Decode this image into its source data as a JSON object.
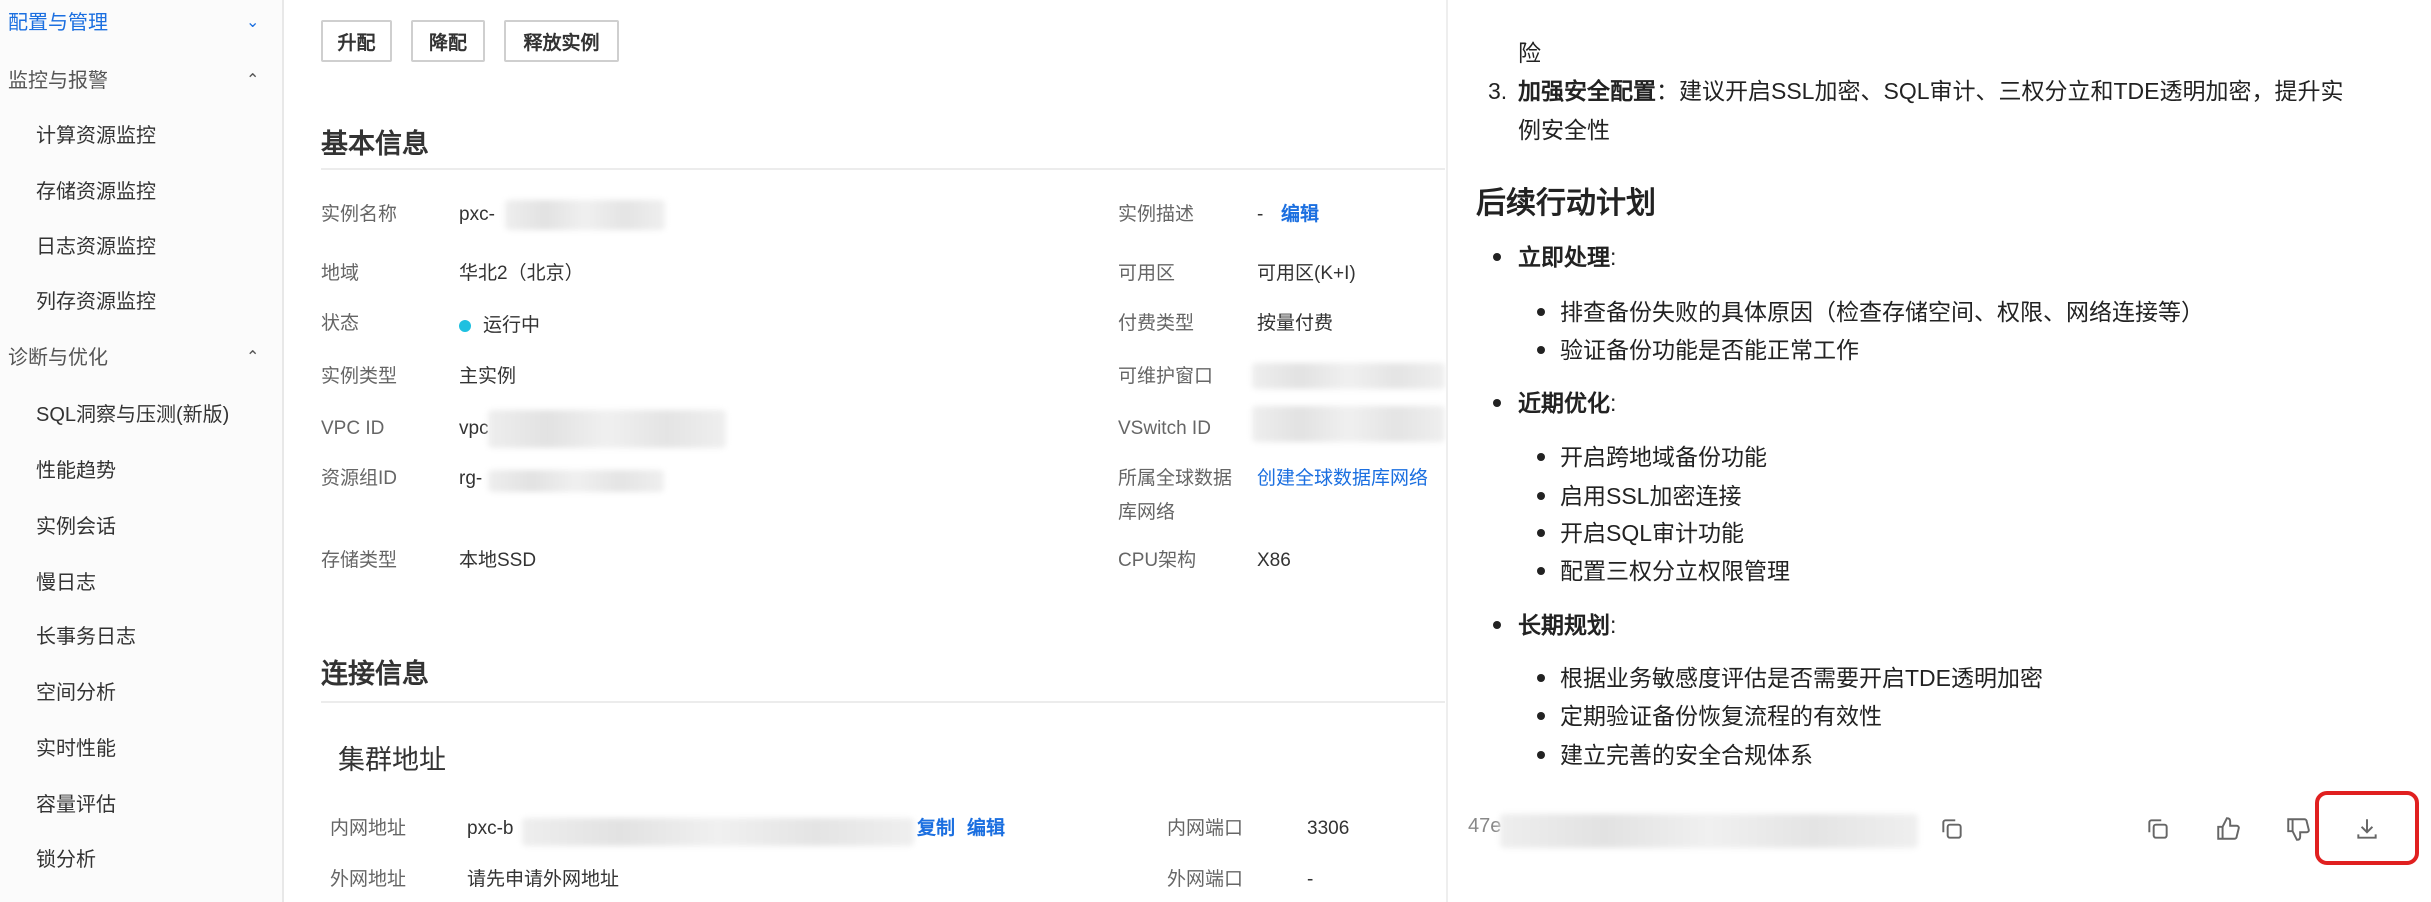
{
  "sidebar": {
    "items": [
      {
        "label": "配置与管理",
        "type": "group",
        "active": true,
        "chevron": "chevron-down"
      },
      {
        "label": "监控与报警",
        "type": "group",
        "chevron": "chevron-up"
      },
      {
        "label": "计算资源监控",
        "type": "sub"
      },
      {
        "label": "存储资源监控",
        "type": "sub"
      },
      {
        "label": "日志资源监控",
        "type": "sub"
      },
      {
        "label": "列存资源监控",
        "type": "sub"
      },
      {
        "label": "诊断与优化",
        "type": "group",
        "chevron": "chevron-up"
      },
      {
        "label": "SQL洞察与压测(新版)",
        "type": "sub"
      },
      {
        "label": "性能趋势",
        "type": "sub"
      },
      {
        "label": "实例会话",
        "type": "sub"
      },
      {
        "label": "慢日志",
        "type": "sub"
      },
      {
        "label": "长事务日志",
        "type": "sub"
      },
      {
        "label": "空间分析",
        "type": "sub"
      },
      {
        "label": "实时性能",
        "type": "sub"
      },
      {
        "label": "容量评估",
        "type": "sub"
      },
      {
        "label": "锁分析",
        "type": "sub"
      }
    ]
  },
  "toolbar": {
    "upgrade": "升配",
    "downgrade": "降配",
    "release": "释放实例"
  },
  "basic_info": {
    "title": "基本信息",
    "name_label": "实例名称",
    "name_value": "pxc-",
    "desc_label": "实例描述",
    "desc_value": "-",
    "desc_edit": "编辑",
    "region_label": "地域",
    "region_value": "华北2（北京）",
    "zone_label": "可用区",
    "zone_value": "可用区(K+I)",
    "status_label": "状态",
    "status_value": "运行中",
    "billing_label": "付费类型",
    "billing_value": "按量付费",
    "type_label": "实例类型",
    "type_value": "主实例",
    "maint_label": "可维护窗口",
    "vpc_label": "VPC ID",
    "vpc_value": "vpc",
    "vswitch_label": "VSwitch ID",
    "rg_label": "资源组ID",
    "rg_value": "rg-",
    "gdn_label_1": "所属全球数据",
    "gdn_label_2": "库网络",
    "gdn_link": "创建全球数据库网络",
    "storage_label": "存储类型",
    "storage_value": "本地SSD",
    "cpu_label": "CPU架构",
    "cpu_value": "X86",
    "status_color": "#1ec0e0"
  },
  "connection": {
    "title": "连接信息",
    "cluster_title": "集群地址",
    "private_label": "内网地址",
    "private_value": "pxc-b",
    "copy": "复制",
    "edit": "编辑",
    "private_port_label": "内网端口",
    "private_port_value": "3306",
    "public_label": "外网地址",
    "public_value": "请先申请外网地址",
    "public_port_label": "外网端口",
    "public_port_value": "-"
  },
  "panel": {
    "cont_line": "险",
    "item3_num": "3.",
    "item3_bold": "加强安全配置",
    "item3_text": "：建议开启SSL加密、SQL审计、三权分立和TDE透明加密，提升实",
    "item3_cont": "例安全性",
    "plan_title": "后续行动计划",
    "groups": [
      {
        "title": "立即处理",
        "items": [
          "排查备份失败的具体原因（检查存储空间、权限、网络连接等）",
          "验证备份功能是否能正常工作"
        ]
      },
      {
        "title": "近期优化",
        "items": [
          "开启跨地域备份功能",
          "启用SSL加密连接",
          "开启SQL审计功能",
          "配置三权分立权限管理"
        ]
      },
      {
        "title": "长期规划",
        "items": [
          "根据业务敏感度评估是否需要开启TDE透明加密",
          "定期验证备份恢复流程的有效性",
          "建立完善的安全合规体系"
        ]
      }
    ],
    "colon": ":",
    "footer_id": "47e",
    "icons": [
      "copy-icon",
      "copy-icon",
      "thumbs-up-icon",
      "thumbs-down-icon",
      "download-icon"
    ],
    "highlight_color": "#e02020"
  }
}
